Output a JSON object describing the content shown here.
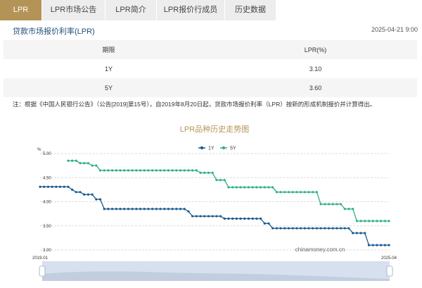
{
  "tabs": [
    "LPR",
    "LPR市场公告",
    "LPR简介",
    "LPR报价行成员",
    "历史数据"
  ],
  "active_tab_index": 0,
  "accent_color": "#b49456",
  "header": {
    "title": "贷款市场报价利率(LPR)",
    "timestamp": "2025-04-21 9:00"
  },
  "table": {
    "headers": [
      "期限",
      "LPR(%)"
    ],
    "rows": [
      [
        "1Y",
        "3.10"
      ],
      [
        "5Y",
        "3.60"
      ]
    ]
  },
  "note": "注：根据《中国人民银行公告》（公告[2019]第15号），自2019年8月20日起，贷款市场报价利率（LPR）按新的形成机制报价并计算得出。",
  "chart_data": {
    "type": "line",
    "title": "LPR品种历史走势图",
    "watermark": "chinamoney.com.cn",
    "ylabel": "%",
    "ylim": [
      3.0,
      5.0
    ],
    "yticks": [
      "5.00",
      "4.50",
      "4.00",
      "3.50",
      "3.00"
    ],
    "x_start_label": "2019-01",
    "x_end_label": "2025-04",
    "legend_position": "top-center",
    "grid": true,
    "series": [
      {
        "name": "1Y",
        "color": "#1b5b8e",
        "values": [
          4.31,
          4.31,
          4.31,
          4.31,
          4.31,
          4.31,
          4.31,
          4.31,
          4.25,
          4.2,
          4.2,
          4.15,
          4.15,
          4.15,
          4.05,
          4.05,
          3.85,
          3.85,
          3.85,
          3.85,
          3.85,
          3.85,
          3.85,
          3.85,
          3.85,
          3.85,
          3.85,
          3.85,
          3.85,
          3.85,
          3.85,
          3.85,
          3.85,
          3.85,
          3.85,
          3.85,
          3.85,
          3.8,
          3.7,
          3.7,
          3.7,
          3.7,
          3.7,
          3.7,
          3.7,
          3.7,
          3.65,
          3.65,
          3.65,
          3.65,
          3.65,
          3.65,
          3.65,
          3.65,
          3.65,
          3.65,
          3.55,
          3.55,
          3.45,
          3.45,
          3.45,
          3.45,
          3.45,
          3.45,
          3.45,
          3.45,
          3.45,
          3.45,
          3.45,
          3.45,
          3.45,
          3.45,
          3.45,
          3.45,
          3.45,
          3.45,
          3.45,
          3.45,
          3.35,
          3.35,
          3.35,
          3.35,
          3.1,
          3.1,
          3.1,
          3.1,
          3.1,
          3.1
        ]
      },
      {
        "name": "5Y",
        "color": "#2db08a",
        "values": [
          null,
          null,
          null,
          null,
          null,
          null,
          null,
          4.85,
          4.85,
          4.85,
          4.8,
          4.8,
          4.8,
          4.75,
          4.75,
          4.65,
          4.65,
          4.65,
          4.65,
          4.65,
          4.65,
          4.65,
          4.65,
          4.65,
          4.65,
          4.65,
          4.65,
          4.65,
          4.65,
          4.65,
          4.65,
          4.65,
          4.65,
          4.65,
          4.65,
          4.65,
          4.65,
          4.65,
          4.65,
          4.65,
          4.6,
          4.6,
          4.6,
          4.6,
          4.45,
          4.45,
          4.45,
          4.3,
          4.3,
          4.3,
          4.3,
          4.3,
          4.3,
          4.3,
          4.3,
          4.3,
          4.3,
          4.3,
          4.3,
          4.2,
          4.2,
          4.2,
          4.2,
          4.2,
          4.2,
          4.2,
          4.2,
          4.2,
          4.2,
          4.2,
          3.95,
          3.95,
          3.95,
          3.95,
          3.95,
          3.95,
          3.85,
          3.85,
          3.85,
          3.6,
          3.6,
          3.6,
          3.6,
          3.6,
          3.6,
          3.6,
          3.6,
          3.6
        ]
      }
    ]
  }
}
